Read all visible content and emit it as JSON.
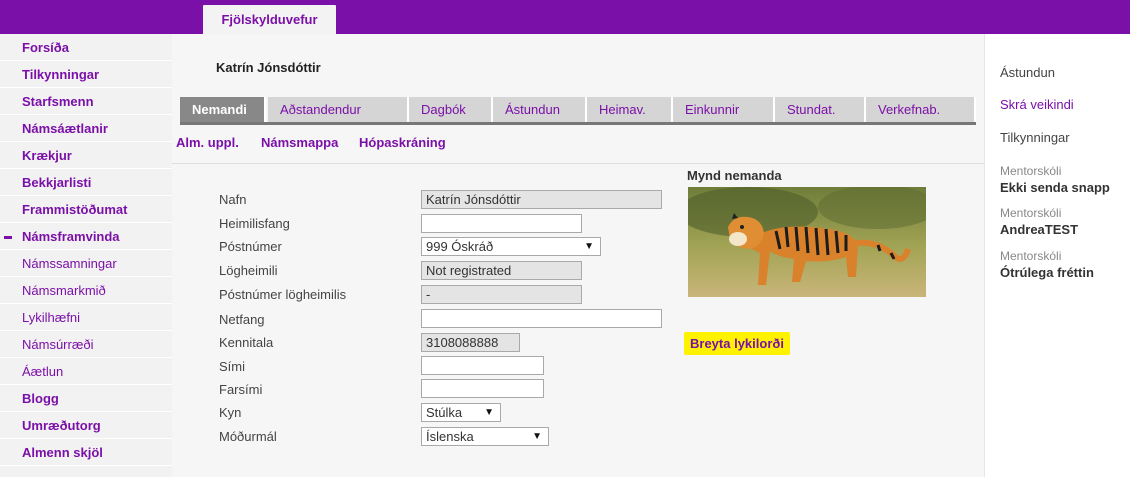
{
  "app": {
    "tab_label": "Fjölskylduvefur"
  },
  "sidebar": {
    "items": [
      {
        "label": "Forsíða"
      },
      {
        "label": "Tilkynningar"
      },
      {
        "label": "Starfsmenn"
      },
      {
        "label": "Námsáætlanir"
      },
      {
        "label": "Krækjur"
      },
      {
        "label": "Bekkjarlisti"
      },
      {
        "label": "Frammistöðumat"
      },
      {
        "label": "Námsframvinda"
      },
      {
        "label": "Námssamningar"
      },
      {
        "label": "Námsmarkmið"
      },
      {
        "label": "Lykilhæfni"
      },
      {
        "label": "Námsúrræði"
      },
      {
        "label": "Áætlun"
      },
      {
        "label": "Blogg"
      },
      {
        "label": "Umræðutorg"
      },
      {
        "label": "Almenn skjöl"
      }
    ]
  },
  "main": {
    "student_name": "Katrín Jónsdóttir",
    "tabs": [
      {
        "label": "Nemandi"
      },
      {
        "label": "Aðstandendur"
      },
      {
        "label": "Dagbók"
      },
      {
        "label": "Ástundun"
      },
      {
        "label": "Heimav."
      },
      {
        "label": "Einkunnir"
      },
      {
        "label": "Stundat."
      },
      {
        "label": "Verkefnab."
      }
    ],
    "subnav": [
      {
        "label": "Alm. uppl."
      },
      {
        "label": "Námsmappa"
      },
      {
        "label": "Hópaskráning"
      }
    ],
    "form": {
      "name": {
        "label": "Nafn",
        "value": "Katrín Jónsdóttir"
      },
      "address": {
        "label": "Heimilisfang",
        "value": ""
      },
      "postcode": {
        "label": "Póstnúmer",
        "value": "999 Óskráð"
      },
      "legal_residence": {
        "label": "Lögheimili",
        "value": "Not registrated"
      },
      "legal_postcode": {
        "label": "Póstnúmer lögheimilis",
        "value": "-"
      },
      "email": {
        "label": "Netfang",
        "value": ""
      },
      "kennitala": {
        "label": "Kennitala",
        "value": "3108088888"
      },
      "phone": {
        "label": "Sími",
        "value": ""
      },
      "mobile": {
        "label": "Farsími",
        "value": ""
      },
      "gender": {
        "label": "Kyn",
        "value": "Stúlka"
      },
      "mother_tongue": {
        "label": "Móðurmál",
        "value": "Íslenska"
      }
    },
    "photo_title": "Mynd nemanda",
    "change_password": "Breyta lykilorði"
  },
  "right": {
    "links": [
      "Ástundun",
      "Skrá veikindi",
      "Tilkynningar"
    ],
    "mentor_items": [
      {
        "label": "Mentorskóli",
        "title": "Ekki senda snapp"
      },
      {
        "label": "Mentorskóli",
        "title": "AndreaTEST"
      },
      {
        "label": "Mentorskóli",
        "title": "Ótrúlega fréttin"
      }
    ]
  },
  "colors": {
    "brand": "#7b10a8",
    "highlight": "#fff200"
  },
  "icons": {
    "dropdown": "caret-down-icon",
    "current_item": "dash-marker-icon"
  }
}
